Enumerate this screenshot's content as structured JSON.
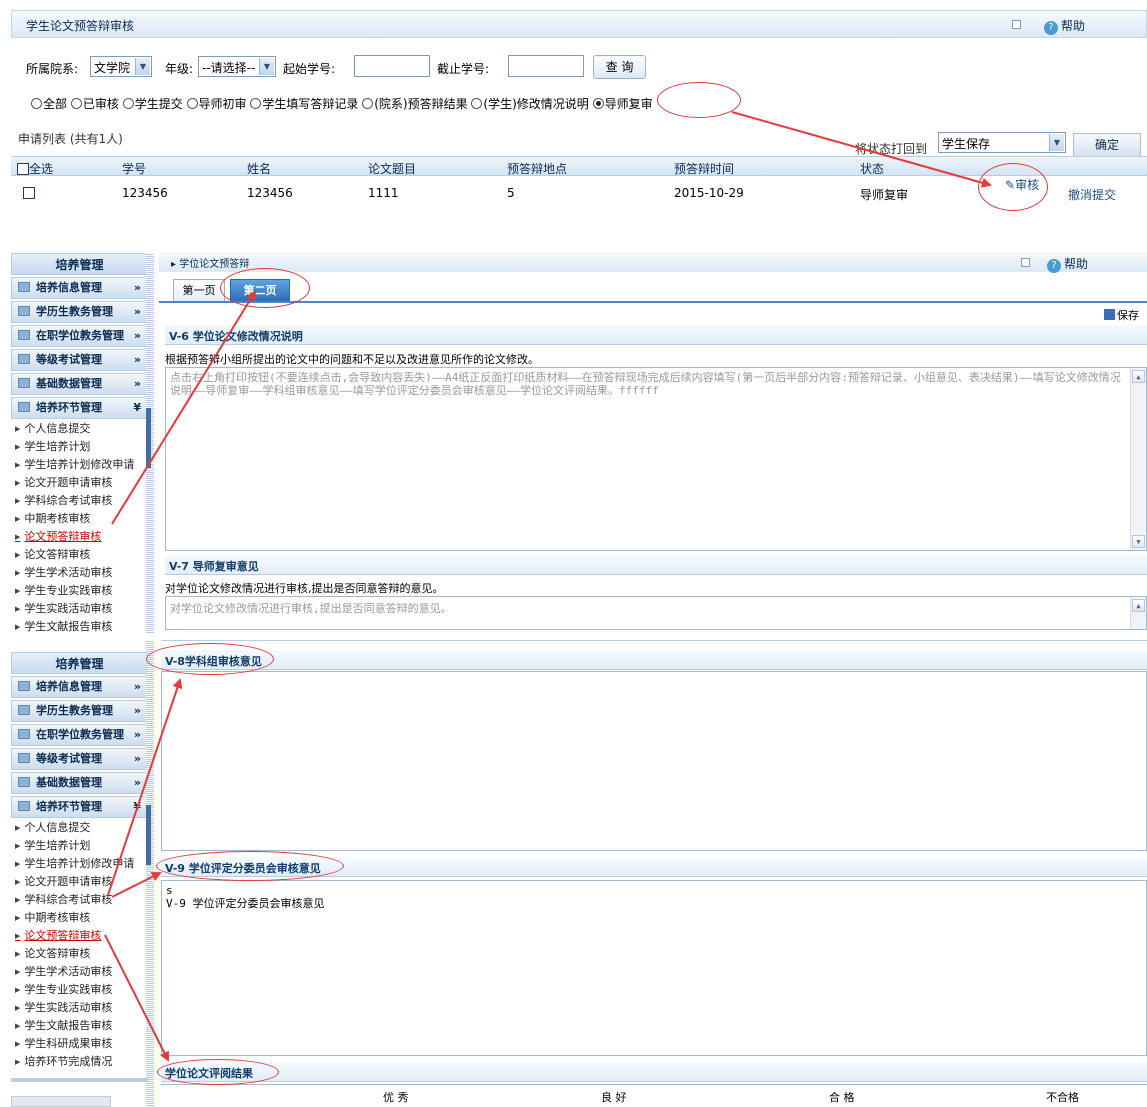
{
  "section1": {
    "title": "学生论文预答辩审核",
    "help": "帮助",
    "filters": {
      "dept_label": "所属院系:",
      "dept_value": "文学院",
      "grade_label": "年级:",
      "grade_value": "--请选择--",
      "start_label": "起始学号:",
      "end_label": "截止学号:",
      "query_button": "查 询"
    },
    "radios": [
      "全部",
      "已审核",
      "学生提交",
      "导师初审",
      "学生填写答辩记录",
      "(院系)预答辩结果",
      "(学生)修改情况说明",
      "导师复审"
    ],
    "radio_selected": "导师复审",
    "list_title": "申请列表 (共有1人)",
    "revert_label": "将状态打回到",
    "revert_value": "学生保存",
    "confirm_button": "确定",
    "columns": [
      "全选",
      "学号",
      "姓名",
      "论文题目",
      "预答辩地点",
      "预答辩时间",
      "状态"
    ],
    "row": {
      "student_id": "123456",
      "name": "123456",
      "title": "1111",
      "location": "5",
      "time": "2015-10-29",
      "status": "导师复审",
      "review_link": "审核",
      "cancel_link": "撤消提交"
    }
  },
  "sidebar": {
    "title": "培养管理",
    "menus": [
      "培养信息管理",
      "学历生教务管理",
      "在职学位教务管理",
      "等级考试管理",
      "基础数据管理",
      "培养环节管理"
    ],
    "items_a": [
      "个人信息提交",
      "学生培养计划",
      "学生培养计划修改申请",
      "论文开题申请审核",
      "学科综合考试审核",
      "中期考核审核",
      "论文预答辩审核",
      "论文答辩审核",
      "学生学术活动审核",
      "学生专业实践审核",
      "学生实践活动审核",
      "学生文献报告审核"
    ],
    "items_b": [
      "个人信息提交",
      "学生培养计划",
      "学生培养计划修改申请",
      "论文开题申请审核",
      "学科综合考试审核",
      "中期考核审核",
      "论文预答辩审核",
      "论文答辩审核",
      "学生学术活动审核",
      "学生专业实践审核",
      "学生实践活动审核",
      "学生文献报告审核",
      "学生科研成果审核",
      "培养环节完成情况"
    ],
    "active": "论文预答辩审核"
  },
  "section2": {
    "breadcrumb": "学位论文预答辩",
    "help": "帮助",
    "tab1": "第一页",
    "tab2": "第二页",
    "save": "保存",
    "v6_title": "V-6 学位论文修改情况说明",
    "v6_desc": "根据预答辩小组所提出的论文中的问题和不足以及改进意见所作的论文修改。",
    "v6_text": "点击右上角打印按钮(不要连续点击,会导致内容丢失)——A4纸正反面打印纸质材料——在预答辩现场完成后续内容填写(第一页后半部分内容:预答辩记录、小组意见、表决结果)——填写论文修改情况说明——导师复审——学科组审核意见——填写学位评定分委员会审核意见——学位论文评阅结果。ffffff",
    "v7_title": "V-7 导师复审意见",
    "v7_desc": "对学位论文修改情况进行审核,提出是否同意答辩的意见。",
    "v7_placeholder": "对学位论文修改情况进行审核,提出是否同意答辩的意见。"
  },
  "section3": {
    "v8_title": "V-8学科组审核意见",
    "v9_title": "V-9 学位评定分委员会审核意见",
    "v9_text_line1": "s",
    "v9_text_line2": "V-9 学位评定分委员会审核意见",
    "eval_title": "学位论文评阅结果",
    "eval_cols": [
      "优 秀",
      "良 好",
      "合 格",
      "不合格"
    ]
  }
}
